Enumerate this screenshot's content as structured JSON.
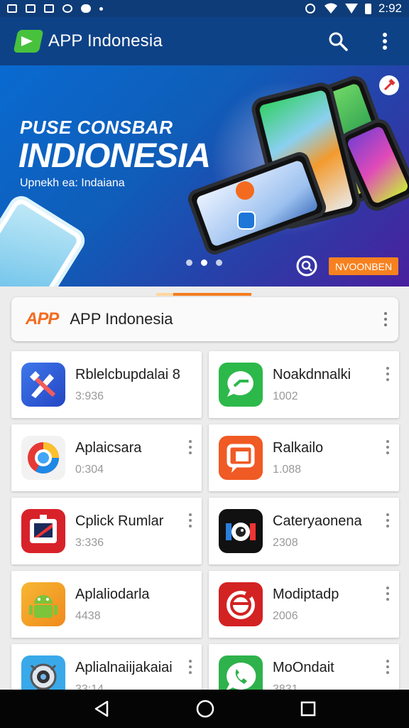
{
  "status_bar": {
    "time": "2:92"
  },
  "app_bar": {
    "title": "APP Indonesia",
    "icons": [
      "search-icon",
      "more-vert-icon"
    ]
  },
  "banner": {
    "subtitle": "PUSE CONSBAR",
    "title": "INDIONESIA",
    "tagline": "Upnekh ea: Indaiana",
    "button_label": "NVOONBEN",
    "pages": 3,
    "active_page": 2
  },
  "header_card": {
    "badge": "APP",
    "title": "APP Indonesia"
  },
  "apps": [
    {
      "name": "Rblelcbupdalai 8",
      "meta": "3:936",
      "icon": "edit-tools-icon",
      "color": "#2f5bd8"
    },
    {
      "name": "Noakdnnalki",
      "meta": "1002",
      "icon": "chat-bubble-icon",
      "color": "#2db84a"
    },
    {
      "name": "Aplaicsara",
      "meta": "0:304",
      "icon": "browser-icon",
      "color": "#f2f2f2"
    },
    {
      "name": "Ralkailo",
      "meta": "1.088",
      "icon": "message-icon",
      "color": "#f05a24"
    },
    {
      "name": "Cplick Rumlar",
      "meta": "3:336",
      "icon": "photo-frame-icon",
      "color": "#d8222a"
    },
    {
      "name": "Cateryaonena",
      "meta": "2308",
      "icon": "camera-lens-icon",
      "color": "#111111"
    },
    {
      "name": "Aplaliodarla",
      "meta": "4438",
      "icon": "android-icon",
      "color": "#f5a623"
    },
    {
      "name": "Modiptadp",
      "meta": "2006",
      "icon": "spiral-icon",
      "color": "#d32222"
    },
    {
      "name": "Aplialnaiijakaiai",
      "meta": "33:14",
      "icon": "webcam-icon",
      "color": "#39a9ea"
    },
    {
      "name": "MoOndait",
      "meta": "3831",
      "icon": "phone-bubble-icon",
      "color": "#2eb24b"
    }
  ]
}
